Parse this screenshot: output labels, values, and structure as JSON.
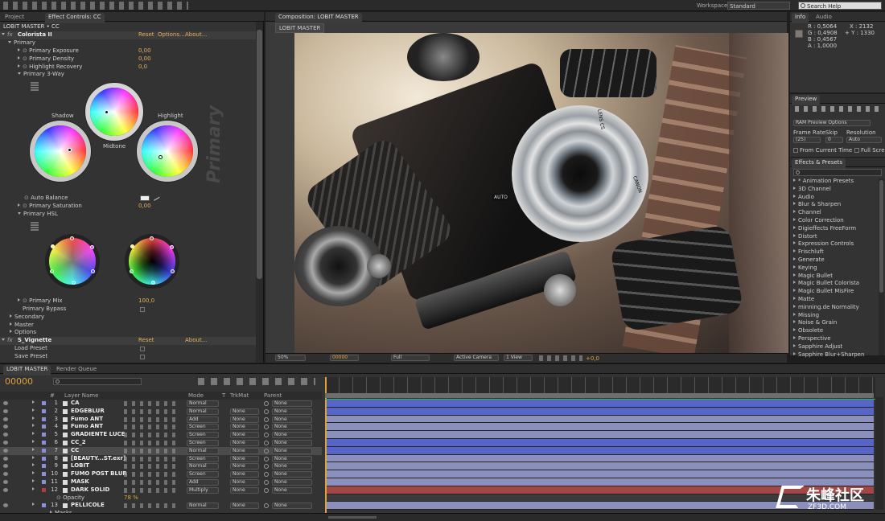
{
  "app": {
    "toolbar": {
      "search_placeholder": "Search Help",
      "workspace_label": "Workspace:",
      "workspace_value": "Standard"
    }
  },
  "effect_panel": {
    "tabs": [
      "Project",
      "Effect Controls: CC"
    ],
    "breadcrumb": "LOBIT MASTER • CC",
    "effects": [
      {
        "name": "Colorista II",
        "reset": "Reset",
        "options": "Options...",
        "about": "About..."
      },
      {
        "name": "S_Vignette",
        "reset": "Reset",
        "about": "About..."
      }
    ],
    "rows": [
      {
        "label": "Primary",
        "value": ""
      },
      {
        "label": "Primary Exposure",
        "value": "0,00"
      },
      {
        "label": "Primary Density",
        "value": "0,00"
      },
      {
        "label": "Highlight Recovery",
        "value": "0,0"
      },
      {
        "label": "Primary 3-Way",
        "value": ""
      }
    ],
    "wheel_labels": {
      "shadow": "Shadow",
      "midtone": "Midtone",
      "highlight": "Highlight",
      "primary_big": "Primary"
    },
    "rows2": [
      {
        "label": "Auto Balance",
        "value": ""
      },
      {
        "label": "Primary Saturation",
        "value": "0,00"
      },
      {
        "label": "Primary HSL",
        "value": ""
      }
    ],
    "rows3": [
      {
        "label": "Primary Mix",
        "value": "100,0"
      },
      {
        "label": "Primary Bypass",
        "value": ""
      },
      {
        "label": "Secondary",
        "value": ""
      },
      {
        "label": "Master",
        "value": ""
      },
      {
        "label": "Options",
        "value": ""
      }
    ],
    "vignette_rows": [
      "Load Preset",
      "Save Preset"
    ]
  },
  "composition": {
    "tab": "Composition: LOBIT MASTER",
    "subtab": "LOBIT MASTER",
    "footer": {
      "zoom": "50%",
      "timecode": "00000",
      "resolution": "Full",
      "camera": "Active Camera",
      "view": "1 View",
      "exposure": "+0,0"
    },
    "lens_text": {
      "auto": "AUTO",
      "lens": "LENS CS",
      "brand": "ZOOM",
      "canon": "CANON"
    }
  },
  "info_panel": {
    "tabs": [
      "Info",
      "Audio"
    ],
    "r": "R : 0,5064",
    "g": "G : 0,4908",
    "b": "B : 0,4567",
    "a": "A : 1,0000",
    "x": "X : 2132",
    "y": "+ Y : 1330"
  },
  "preview_panel": {
    "tab": "Preview",
    "ram": "RAM Preview Options",
    "frame_rate_label": "Frame Rate",
    "skip_label": "Skip",
    "resolution_label": "Resolution",
    "frame_rate_value": "(25)",
    "skip_value": "0",
    "resolution_value": "Auto",
    "from_current": "From Current Time",
    "full_screen": "Full Screen"
  },
  "effects_presets": {
    "tab": "Effects & Presets",
    "items": [
      "* Animation Presets",
      "3D Channel",
      "Audio",
      "Blur & Sharpen",
      "Channel",
      "Color Correction",
      "Digieffects FreeForm",
      "Distort",
      "Expression Controls",
      "Frischluft",
      "Generate",
      "Keying",
      "Magic Bullet",
      "Magic Bullet Colorista",
      "Magic Bullet MisFire",
      "Matte",
      "minning.de Normality",
      "Missing",
      "Noise & Grain",
      "Obsolete",
      "Perspective",
      "Sapphire Adjust",
      "Sapphire Blur+Sharpen"
    ]
  },
  "timeline": {
    "tabs": [
      "LOBIT MASTER",
      "Render Queue"
    ],
    "timecode": "00000",
    "headers": {
      "num": "#",
      "name": "Layer Name",
      "mode": "Mode",
      "t": "T",
      "trkmat": "TrkMat",
      "parent": "Parent"
    },
    "layers": [
      {
        "num": "1",
        "name": "CA",
        "mode": "Normal",
        "trk": "",
        "parent": "None",
        "color": "#8c8fd6",
        "track": "#5865c8"
      },
      {
        "num": "2",
        "name": "EDGEBLUR",
        "mode": "Normal",
        "trk": "None",
        "parent": "None",
        "color": "#8c8fd6",
        "track": "#5865c8"
      },
      {
        "num": "3",
        "name": "Fumo ANT",
        "mode": "Add",
        "trk": "None",
        "parent": "None",
        "color": "#8c8fd6",
        "track": "#8b8fbb"
      },
      {
        "num": "4",
        "name": "Fumo ANT",
        "mode": "Screen",
        "trk": "None",
        "parent": "None",
        "color": "#8c8fd6",
        "track": "#8b8fbb"
      },
      {
        "num": "5",
        "name": "GRADIENTE LUCE",
        "mode": "Screen",
        "trk": "None",
        "parent": "None",
        "color": "#8c8fd6",
        "track": "#8b8fbb"
      },
      {
        "num": "6",
        "name": "CC_2",
        "mode": "Screen",
        "trk": "None",
        "parent": "None",
        "color": "#8c8fd6",
        "track": "#5865c8"
      },
      {
        "num": "7",
        "name": "CC",
        "mode": "Normal",
        "trk": "None",
        "parent": "None",
        "color": "#8c8fd6",
        "track": "#5865c8"
      },
      {
        "num": "8",
        "name": "[BEAUTY...ST.exr]",
        "mode": "Screen",
        "trk": "None",
        "parent": "None",
        "color": "#8c8fd6",
        "track": "#8b8fbb"
      },
      {
        "num": "9",
        "name": "LOBIT",
        "mode": "Normal",
        "trk": "None",
        "parent": "None",
        "color": "#8c8fd6",
        "track": "#8b8fbb"
      },
      {
        "num": "10",
        "name": "FUMO POST BLUR",
        "mode": "Screen",
        "trk": "None",
        "parent": "None",
        "color": "#8c8fd6",
        "track": "#8b8fbb"
      },
      {
        "num": "11",
        "name": "MASK",
        "mode": "Add",
        "trk": "None",
        "parent": "None",
        "color": "#8c8fd6",
        "track": "#8b8fbb"
      },
      {
        "num": "12",
        "name": "DARK SOLID",
        "mode": "Multiply",
        "trk": "None",
        "parent": "None",
        "color": "#b63b3b",
        "track": "#a24646"
      },
      {
        "num": "",
        "name": "Opacity",
        "mode": "",
        "trk": "",
        "parent": "",
        "color": "",
        "track": "#3b3b3b",
        "value": "78 %"
      },
      {
        "num": "13",
        "name": "PELLICOLE",
        "mode": "Normal",
        "trk": "None",
        "parent": "None",
        "color": "#8c8fd6",
        "track": "#8b8fbb"
      }
    ],
    "masks_label": "Masks"
  },
  "watermark": {
    "cn": "朱峰社区",
    "en": "ZF3D.COM"
  }
}
